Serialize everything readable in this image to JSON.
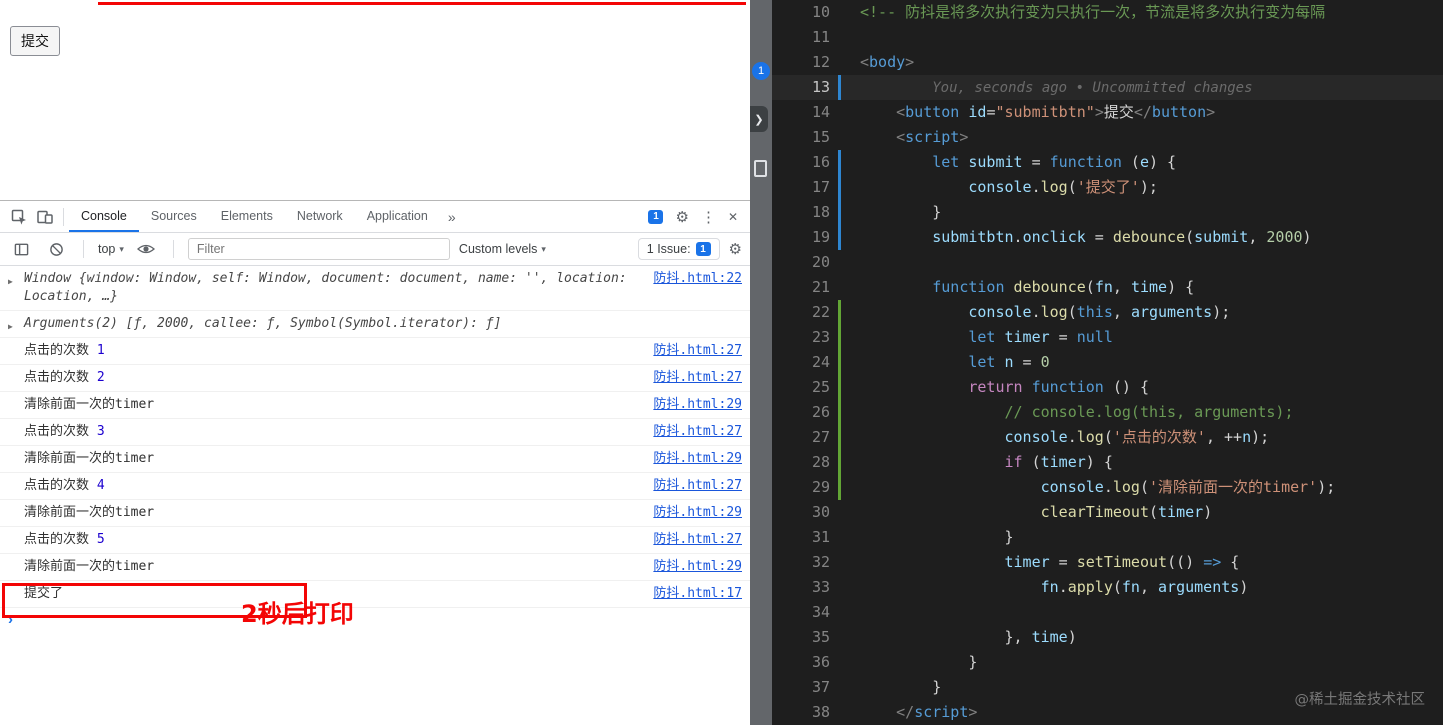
{
  "colors": {
    "accent_blue": "#1a73e8",
    "annotation_red": "#f30505",
    "mark_mod": "#2e86d1",
    "mark_add": "#62a535"
  },
  "page": {
    "submit_button": "提交"
  },
  "annotations": {
    "callout": "2秒后打印"
  },
  "icons": {
    "gear": "⚙",
    "menu": "⋮",
    "close": "✕",
    "overflow": "»",
    "caret": "▾",
    "expand": "▶",
    "prompt": "›",
    "chevron": "❯"
  },
  "strip": {
    "badge": "1"
  },
  "devtools": {
    "tabs": [
      {
        "label": "Console",
        "active": true
      },
      {
        "label": "Sources"
      },
      {
        "label": "Elements"
      },
      {
        "label": "Network"
      },
      {
        "label": "Application"
      }
    ],
    "badge_count": "1",
    "toolbar": {
      "context": "top",
      "filter_placeholder": "Filter",
      "filter_value": "",
      "levels": "Custom levels",
      "issues_label": "1 Issue:",
      "issues_count": "1"
    },
    "messages": [
      {
        "kind": "object",
        "text": "Window {window: Window, self: Window, document: document, name: '', location: Location, …}",
        "source": "防抖.html:22"
      },
      {
        "kind": "object",
        "text": "Arguments(2) [ƒ, 2000, callee: ƒ, Symbol(Symbol.iterator): ƒ]",
        "source": ""
      },
      {
        "kind": "count",
        "text": "点击的次数",
        "count": "1",
        "source": "防抖.html:27"
      },
      {
        "kind": "count",
        "text": "点击的次数",
        "count": "2",
        "source": "防抖.html:27"
      },
      {
        "kind": "plain",
        "text": "清除前面一次的timer",
        "source": "防抖.html:29"
      },
      {
        "kind": "count",
        "text": "点击的次数",
        "count": "3",
        "source": "防抖.html:27"
      },
      {
        "kind": "plain",
        "text": "清除前面一次的timer",
        "source": "防抖.html:29"
      },
      {
        "kind": "count",
        "text": "点击的次数",
        "count": "4",
        "source": "防抖.html:27"
      },
      {
        "kind": "plain",
        "text": "清除前面一次的timer",
        "source": "防抖.html:29"
      },
      {
        "kind": "count",
        "text": "点击的次数",
        "count": "5",
        "source": "防抖.html:27"
      },
      {
        "kind": "plain",
        "text": "清除前面一次的timer",
        "source": "防抖.html:29"
      },
      {
        "kind": "plain",
        "text": "提交了",
        "source": "防抖.html:17",
        "annotated": true
      }
    ]
  },
  "editor": {
    "watermark": "@稀土掘金技术社区",
    "lines": [
      {
        "n": 10,
        "tokens": [
          [
            "cmt",
            "<!-- 防抖是将多次执行变为只执行一次，节流是将多次执行变为每隔"
          ]
        ]
      },
      {
        "n": 11,
        "tokens": []
      },
      {
        "n": 12,
        "tokens": [
          [
            "punct",
            "<"
          ],
          [
            "tag",
            "body"
          ],
          [
            "punct",
            ">"
          ]
        ]
      },
      {
        "n": 13,
        "current": true,
        "mark": "mod",
        "tokens": [
          [
            "pl",
            "        "
          ],
          [
            "blame",
            "You, seconds ago • Uncommitted changes"
          ]
        ]
      },
      {
        "n": 14,
        "tokens": [
          [
            "pl",
            "    "
          ],
          [
            "punct",
            "<"
          ],
          [
            "tag",
            "button"
          ],
          [
            "pl",
            " "
          ],
          [
            "var",
            "id"
          ],
          [
            "pl",
            "="
          ],
          [
            "str",
            "\"submitbtn\""
          ],
          [
            "punct",
            ">"
          ],
          [
            "pl",
            "提交"
          ],
          [
            "punct",
            "</"
          ],
          [
            "tag",
            "button"
          ],
          [
            "punct",
            ">"
          ]
        ]
      },
      {
        "n": 15,
        "tokens": [
          [
            "pl",
            "    "
          ],
          [
            "punct",
            "<"
          ],
          [
            "tag",
            "script"
          ],
          [
            "punct",
            ">"
          ]
        ]
      },
      {
        "n": 16,
        "mark": "mod",
        "tokens": [
          [
            "pl",
            "        "
          ],
          [
            "kw",
            "let"
          ],
          [
            "pl",
            " "
          ],
          [
            "var",
            "submit"
          ],
          [
            "pl",
            " = "
          ],
          [
            "kw",
            "function"
          ],
          [
            "pl",
            " ("
          ],
          [
            "var",
            "e"
          ],
          [
            "pl",
            ") {"
          ]
        ]
      },
      {
        "n": 17,
        "mark": "mod",
        "tokens": [
          [
            "pl",
            "            "
          ],
          [
            "var",
            "console"
          ],
          [
            "pl",
            "."
          ],
          [
            "fn",
            "log"
          ],
          [
            "pl",
            "("
          ],
          [
            "str",
            "'提交了'"
          ],
          [
            "pl",
            ");"
          ]
        ]
      },
      {
        "n": 18,
        "mark": "mod",
        "tokens": [
          [
            "pl",
            "        }"
          ]
        ]
      },
      {
        "n": 19,
        "mark": "mod",
        "tokens": [
          [
            "pl",
            "        "
          ],
          [
            "var",
            "submitbtn"
          ],
          [
            "pl",
            "."
          ],
          [
            "var",
            "onclick"
          ],
          [
            "pl",
            " = "
          ],
          [
            "fn",
            "debounce"
          ],
          [
            "pl",
            "("
          ],
          [
            "var",
            "submit"
          ],
          [
            "pl",
            ", "
          ],
          [
            "num",
            "2000"
          ],
          [
            "pl",
            ")"
          ]
        ]
      },
      {
        "n": 20,
        "tokens": []
      },
      {
        "n": 21,
        "tokens": [
          [
            "pl",
            "        "
          ],
          [
            "kw",
            "function"
          ],
          [
            "pl",
            " "
          ],
          [
            "fn",
            "debounce"
          ],
          [
            "pl",
            "("
          ],
          [
            "var",
            "fn"
          ],
          [
            "pl",
            ", "
          ],
          [
            "var",
            "time"
          ],
          [
            "pl",
            ") {"
          ]
        ]
      },
      {
        "n": 22,
        "mark": "add",
        "tokens": [
          [
            "pl",
            "            "
          ],
          [
            "var",
            "console"
          ],
          [
            "pl",
            "."
          ],
          [
            "fn",
            "log"
          ],
          [
            "pl",
            "("
          ],
          [
            "kw",
            "this"
          ],
          [
            "pl",
            ", "
          ],
          [
            "var",
            "arguments"
          ],
          [
            "pl",
            ");"
          ]
        ]
      },
      {
        "n": 23,
        "mark": "add",
        "tokens": [
          [
            "pl",
            "            "
          ],
          [
            "kw",
            "let"
          ],
          [
            "pl",
            " "
          ],
          [
            "var",
            "timer"
          ],
          [
            "pl",
            " = "
          ],
          [
            "kw",
            "null"
          ]
        ]
      },
      {
        "n": 24,
        "mark": "add",
        "tokens": [
          [
            "pl",
            "            "
          ],
          [
            "kw",
            "let"
          ],
          [
            "pl",
            " "
          ],
          [
            "var",
            "n"
          ],
          [
            "pl",
            " = "
          ],
          [
            "num",
            "0"
          ]
        ]
      },
      {
        "n": 25,
        "mark": "add",
        "tokens": [
          [
            "pl",
            "            "
          ],
          [
            "ctrl",
            "return"
          ],
          [
            "pl",
            " "
          ],
          [
            "kw",
            "function"
          ],
          [
            "pl",
            " () {"
          ]
        ]
      },
      {
        "n": 26,
        "mark": "add",
        "tokens": [
          [
            "pl",
            "                "
          ],
          [
            "cmt",
            "// console.log(this, arguments);"
          ]
        ]
      },
      {
        "n": 27,
        "mark": "add",
        "tokens": [
          [
            "pl",
            "                "
          ],
          [
            "var",
            "console"
          ],
          [
            "pl",
            "."
          ],
          [
            "fn",
            "log"
          ],
          [
            "pl",
            "("
          ],
          [
            "str",
            "'点击的次数'"
          ],
          [
            "pl",
            ", ++"
          ],
          [
            "var",
            "n"
          ],
          [
            "pl",
            ");"
          ]
        ]
      },
      {
        "n": 28,
        "mark": "add",
        "tokens": [
          [
            "pl",
            "                "
          ],
          [
            "ctrl",
            "if"
          ],
          [
            "pl",
            " ("
          ],
          [
            "var",
            "timer"
          ],
          [
            "pl",
            ") {"
          ]
        ]
      },
      {
        "n": 29,
        "mark": "add",
        "tokens": [
          [
            "pl",
            "                    "
          ],
          [
            "var",
            "console"
          ],
          [
            "pl",
            "."
          ],
          [
            "fn",
            "log"
          ],
          [
            "pl",
            "("
          ],
          [
            "str",
            "'清除前面一次的timer'"
          ],
          [
            "pl",
            ");"
          ]
        ]
      },
      {
        "n": 30,
        "tokens": [
          [
            "pl",
            "                    "
          ],
          [
            "fn",
            "clearTimeout"
          ],
          [
            "pl",
            "("
          ],
          [
            "var",
            "timer"
          ],
          [
            "pl",
            ")"
          ]
        ]
      },
      {
        "n": 31,
        "tokens": [
          [
            "pl",
            "                }"
          ]
        ]
      },
      {
        "n": 32,
        "tokens": [
          [
            "pl",
            "                "
          ],
          [
            "var",
            "timer"
          ],
          [
            "pl",
            " = "
          ],
          [
            "fn",
            "setTimeout"
          ],
          [
            "pl",
            "(() "
          ],
          [
            "kw",
            "=>"
          ],
          [
            "pl",
            " {"
          ]
        ]
      },
      {
        "n": 33,
        "tokens": [
          [
            "pl",
            "                    "
          ],
          [
            "var",
            "fn"
          ],
          [
            "pl",
            "."
          ],
          [
            "fn",
            "apply"
          ],
          [
            "pl",
            "("
          ],
          [
            "var",
            "fn"
          ],
          [
            "pl",
            ", "
          ],
          [
            "var",
            "arguments"
          ],
          [
            "pl",
            ")"
          ]
        ]
      },
      {
        "n": 34,
        "tokens": []
      },
      {
        "n": 35,
        "tokens": [
          [
            "pl",
            "                }, "
          ],
          [
            "var",
            "time"
          ],
          [
            "pl",
            ")"
          ]
        ]
      },
      {
        "n": 36,
        "tokens": [
          [
            "pl",
            "            }"
          ]
        ]
      },
      {
        "n": 37,
        "tokens": [
          [
            "pl",
            "        }"
          ]
        ]
      },
      {
        "n": 38,
        "tokens": [
          [
            "pl",
            "    "
          ],
          [
            "punct",
            "</"
          ],
          [
            "tag",
            "script"
          ],
          [
            "punct",
            ">"
          ]
        ]
      }
    ]
  }
}
